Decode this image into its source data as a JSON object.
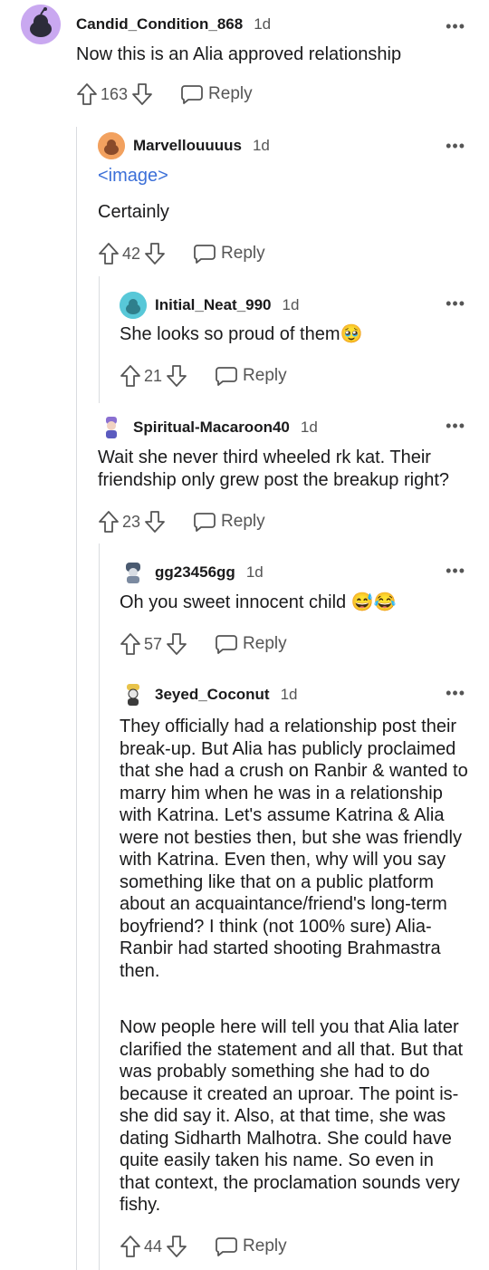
{
  "comments": [
    {
      "username": "Candid_Condition_868",
      "time": "1d",
      "text": "Now this is an Alia approved relationship",
      "upvotes": "163",
      "reply_label": "Reply",
      "avatar_color": "#c9a8f0"
    },
    {
      "username": "Marvellouuuus",
      "time": "1d",
      "image_link": "<image>",
      "text": "Certainly",
      "upvotes": "42",
      "reply_label": "Reply",
      "avatar_color": "#f2a15f"
    },
    {
      "username": "Initial_Neat_990",
      "time": "1d",
      "text": "She looks so proud of them🥹",
      "upvotes": "21",
      "reply_label": "Reply",
      "avatar_color": "#58c8d8"
    },
    {
      "username": "Spiritual-Macaroon40",
      "time": "1d",
      "text": "Wait she never third wheeled rk kat. Their friendship only grew post the breakup right?",
      "upvotes": "23",
      "reply_label": "Reply",
      "avatar_color": "#8a6fd1"
    },
    {
      "username": "gg23456gg",
      "time": "1d",
      "text": "Oh you sweet innocent child 😅😂",
      "upvotes": "57",
      "reply_label": "Reply",
      "avatar_color": "#7b8aa0"
    },
    {
      "username": "3eyed_Coconut",
      "time": "1d",
      "paragraph1": "They officially had a relationship post their break-up. But Alia has publicly proclaimed that she had a crush on Ranbir & wanted to marry him when he was in a relationship with Katrina. Let's assume Katrina & Alia were not besties then, but she was friendly with Katrina. Even then, why will you say something like that on a public platform about an acquaintance/friend's long-term boyfriend? I think (not 100% sure) Alia-Ranbir had started shooting Brahmastra then.",
      "paragraph2": "Now people here will tell you that Alia later clarified the statement and all that. But that was probably something she had to do because it created an uproar. The point is- she did say it. Also, at that time, she was dating Sidharth Malhotra. She could have quite easily taken his name. So even in that context, the proclamation sounds very fishy.",
      "upvotes": "44",
      "reply_label": "Reply",
      "avatar_color": "#e8c34a"
    }
  ],
  "more_icon": "•••"
}
